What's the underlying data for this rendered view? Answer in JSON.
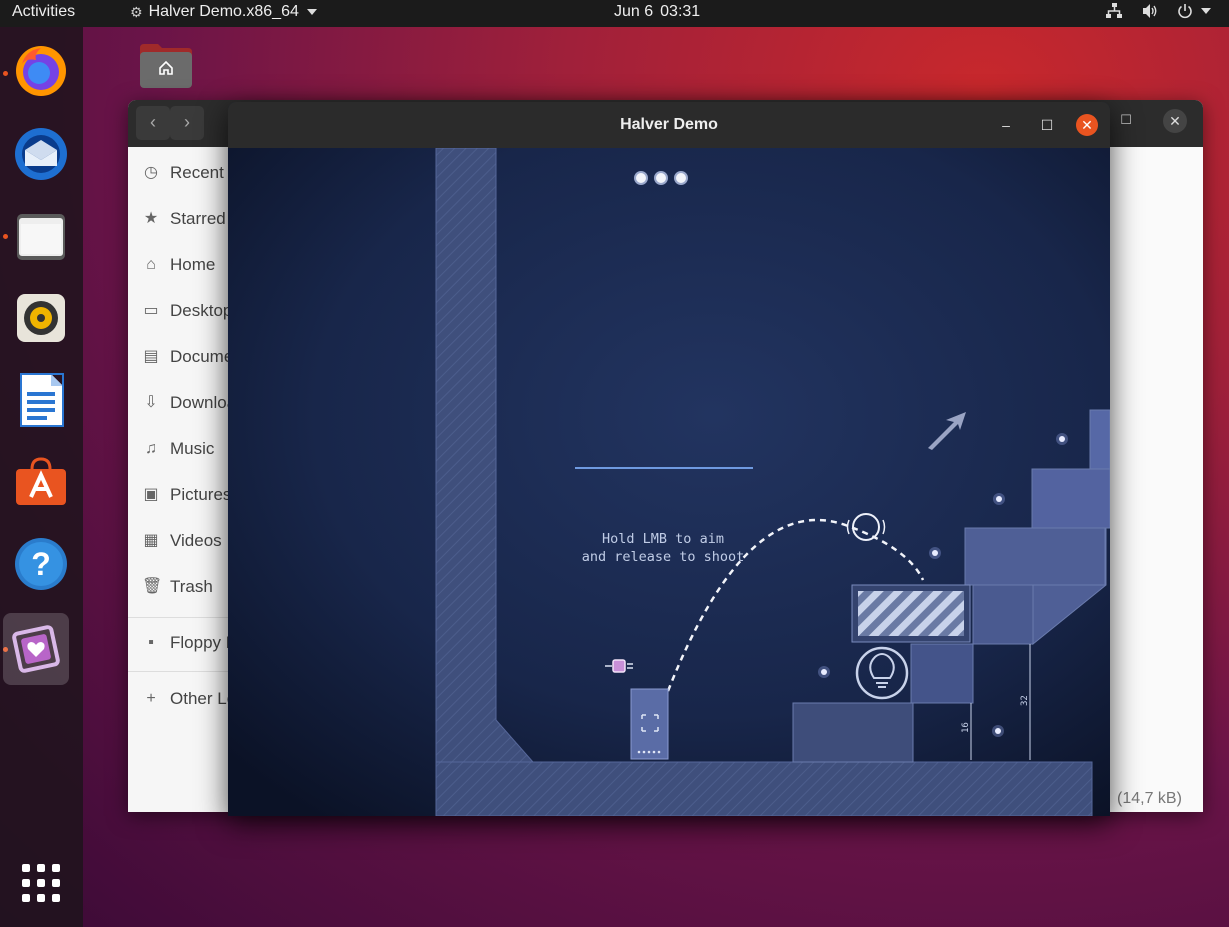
{
  "topbar": {
    "activities": "Activities",
    "app_name": "Halver Demo.x86_64",
    "date": "Jun 6",
    "time": "03:31"
  },
  "dock": {
    "items": [
      {
        "name": "firefox",
        "icon": "firefox-icon",
        "running": true
      },
      {
        "name": "thunderbird",
        "icon": "thunderbird-icon",
        "running": false
      },
      {
        "name": "files",
        "icon": "files-icon",
        "running": true
      },
      {
        "name": "rhythmbox",
        "icon": "rhythmbox-icon",
        "running": false
      },
      {
        "name": "libreoffice-writer",
        "icon": "writer-icon",
        "running": false
      },
      {
        "name": "ubuntu-software",
        "icon": "software-icon",
        "running": false
      },
      {
        "name": "help",
        "icon": "help-icon",
        "running": false
      },
      {
        "name": "halver-demo",
        "icon": "halver-icon",
        "running": true
      }
    ],
    "show_apps_icon": "grid-icon"
  },
  "files_window": {
    "sidebar": [
      {
        "label": "Recent",
        "icon": "clock-icon"
      },
      {
        "label": "Starred",
        "icon": "star-icon"
      },
      {
        "label": "Home",
        "icon": "home-icon"
      },
      {
        "label": "Desktop",
        "icon": "desktop-icon"
      },
      {
        "label": "Documents",
        "icon": "document-icon"
      },
      {
        "label": "Downloads",
        "icon": "download-icon"
      },
      {
        "label": "Music",
        "icon": "music-icon"
      },
      {
        "label": "Pictures",
        "icon": "picture-icon"
      },
      {
        "label": "Videos",
        "icon": "video-icon"
      },
      {
        "label": "Trash",
        "icon": "trash-icon"
      }
    ],
    "floppy": "Floppy Disk",
    "other": "Other Locations",
    "size_label": "(14,7 kB)"
  },
  "game_window": {
    "title": "Halver Demo",
    "hint_line1": "Hold LMB to aim",
    "hint_line2": "and release to shoot",
    "dim_small": "16",
    "dim_large": "32",
    "lives": 3
  },
  "colors": {
    "accent": "#e95420",
    "game_bg": "#151f38",
    "block": "#4a5a86"
  }
}
